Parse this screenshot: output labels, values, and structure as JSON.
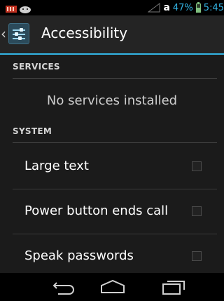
{
  "status_bar": {
    "battery_percent": "47%",
    "time": "5:45",
    "carrier_glyph": "a",
    "icons": [
      "notification-icon",
      "android-icon",
      "signal-icon",
      "battery-icon"
    ]
  },
  "action_bar": {
    "title": "Accessibility",
    "icon": "accessibility-settings-icon",
    "up_icon": "up-caret-icon"
  },
  "sections": {
    "services": {
      "header": "SERVICES",
      "empty_text": "No services installed"
    },
    "system": {
      "header": "SYSTEM",
      "items": [
        {
          "label": "Large text",
          "checked": false
        },
        {
          "label": "Power button ends call",
          "checked": false
        },
        {
          "label": "Speak passwords",
          "checked": false
        }
      ]
    }
  },
  "nav_bar": {
    "buttons": [
      "back-icon",
      "home-icon",
      "recent-apps-icon"
    ]
  },
  "colors": {
    "accent": "#33b5e5",
    "background": "#1b1b1b",
    "status_bar": "#000000"
  }
}
